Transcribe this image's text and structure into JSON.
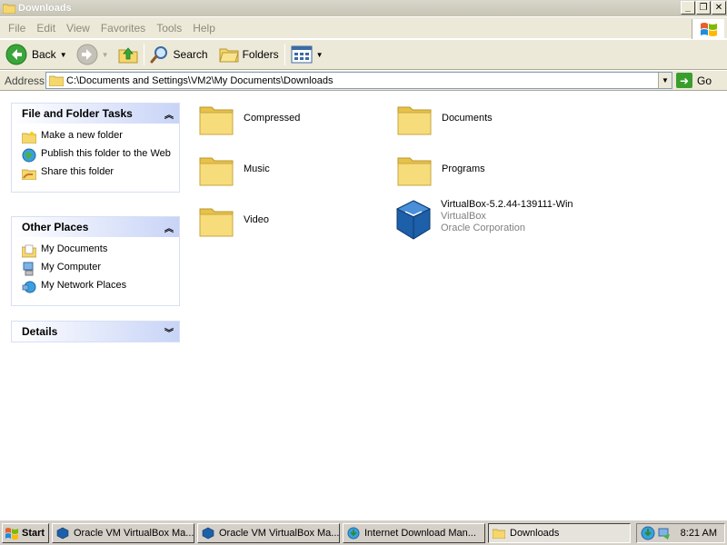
{
  "window": {
    "title": "Downloads",
    "buttons": [
      "_",
      "❐",
      "✕"
    ]
  },
  "menu": [
    "File",
    "Edit",
    "View",
    "Favorites",
    "Tools",
    "Help"
  ],
  "toolbar": {
    "back_label": "Back",
    "search_label": "Search",
    "folders_label": "Folders"
  },
  "address": {
    "label": "Address",
    "value": "C:\\Documents and Settings\\VM2\\My Documents\\Downloads",
    "go_label": "Go"
  },
  "tasks_panel": {
    "title": "File and Folder Tasks",
    "items": [
      {
        "label": "Make a new folder",
        "icon": "new-folder-icon"
      },
      {
        "label": "Publish this folder to the Web",
        "icon": "publish-web-icon"
      },
      {
        "label": "Share this folder",
        "icon": "share-folder-icon"
      }
    ]
  },
  "places_panel": {
    "title": "Other Places",
    "items": [
      {
        "label": "My Documents",
        "icon": "my-documents-icon"
      },
      {
        "label": "My Computer",
        "icon": "my-computer-icon"
      },
      {
        "label": "My Network Places",
        "icon": "network-places-icon"
      }
    ]
  },
  "details_panel": {
    "title": "Details"
  },
  "files": [
    {
      "name": "Compressed",
      "type": "folder"
    },
    {
      "name": "Documents",
      "type": "folder"
    },
    {
      "name": "Music",
      "type": "folder"
    },
    {
      "name": "Programs",
      "type": "folder"
    },
    {
      "name": "Video",
      "type": "folder"
    },
    {
      "name": "VirtualBox-5.2.44-139111-Win",
      "type": "virtualbox-installer",
      "line2": "VirtualBox",
      "line3": "Oracle Corporation"
    }
  ],
  "taskbar": {
    "start_label": "Start",
    "tasks": [
      {
        "label": "Oracle VM VirtualBox Ma...",
        "icon": "virtualbox-icon",
        "active": false
      },
      {
        "label": "Oracle VM VirtualBox Ma...",
        "icon": "virtualbox-icon",
        "active": false
      },
      {
        "label": "Internet Download Man...",
        "icon": "idm-icon",
        "active": false
      },
      {
        "label": "Downloads",
        "icon": "folder-icon",
        "active": true
      }
    ],
    "clock": "8:21 AM"
  },
  "colors": {
    "panel_header_gradient_end": "#c8d4f7",
    "folder_yellow": "#f5d76e",
    "go_green": "#3a9e2d"
  }
}
